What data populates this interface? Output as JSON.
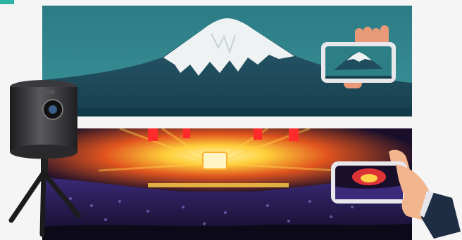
{
  "colors": {
    "accent": "#2bb3a3",
    "sky": "#2d7f86",
    "mountain_base": "#1f4d5e",
    "snow": "#eef2f3",
    "stage_glow": "#ffd24a",
    "stage_red": "#ff3a3a",
    "crowd": "#2a1f5a",
    "phone_frame": "#e8e8ec",
    "camera_body": "#2b2b2e",
    "sleeve": "#1e2d44"
  },
  "icons": {
    "camera": "robotic-360-camera-icon",
    "phone_top": "phone-in-hand-icon",
    "phone_bottom": "phone-in-hand-icon"
  }
}
